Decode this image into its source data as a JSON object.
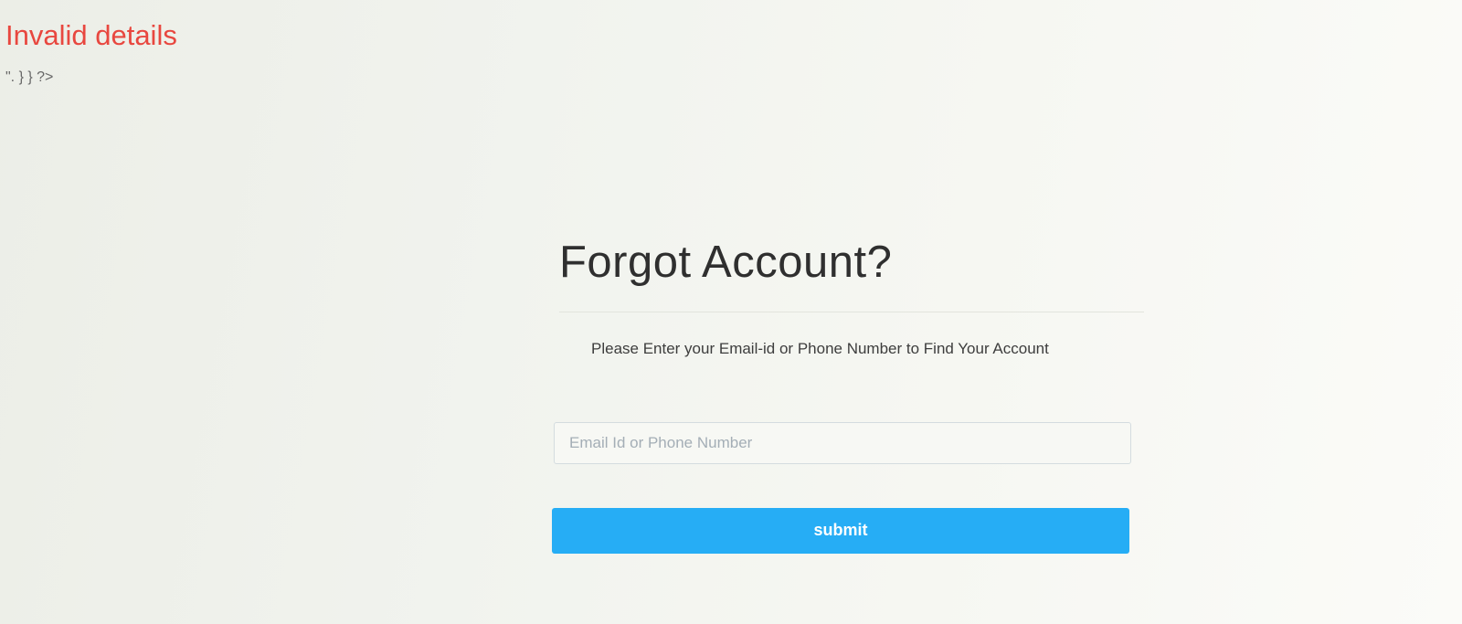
{
  "error": {
    "message": "Invalid details",
    "stray_code": "\". } } ?>"
  },
  "form": {
    "title": "Forgot Account?",
    "instructions": "Please Enter your Email-id or Phone Number to Find Your Account",
    "input": {
      "value": "",
      "placeholder": "Email Id or Phone Number"
    },
    "submit_label": "submit"
  },
  "colors": {
    "error": "#e8473f",
    "button": "#26adf5",
    "button_text": "#ffffff"
  }
}
